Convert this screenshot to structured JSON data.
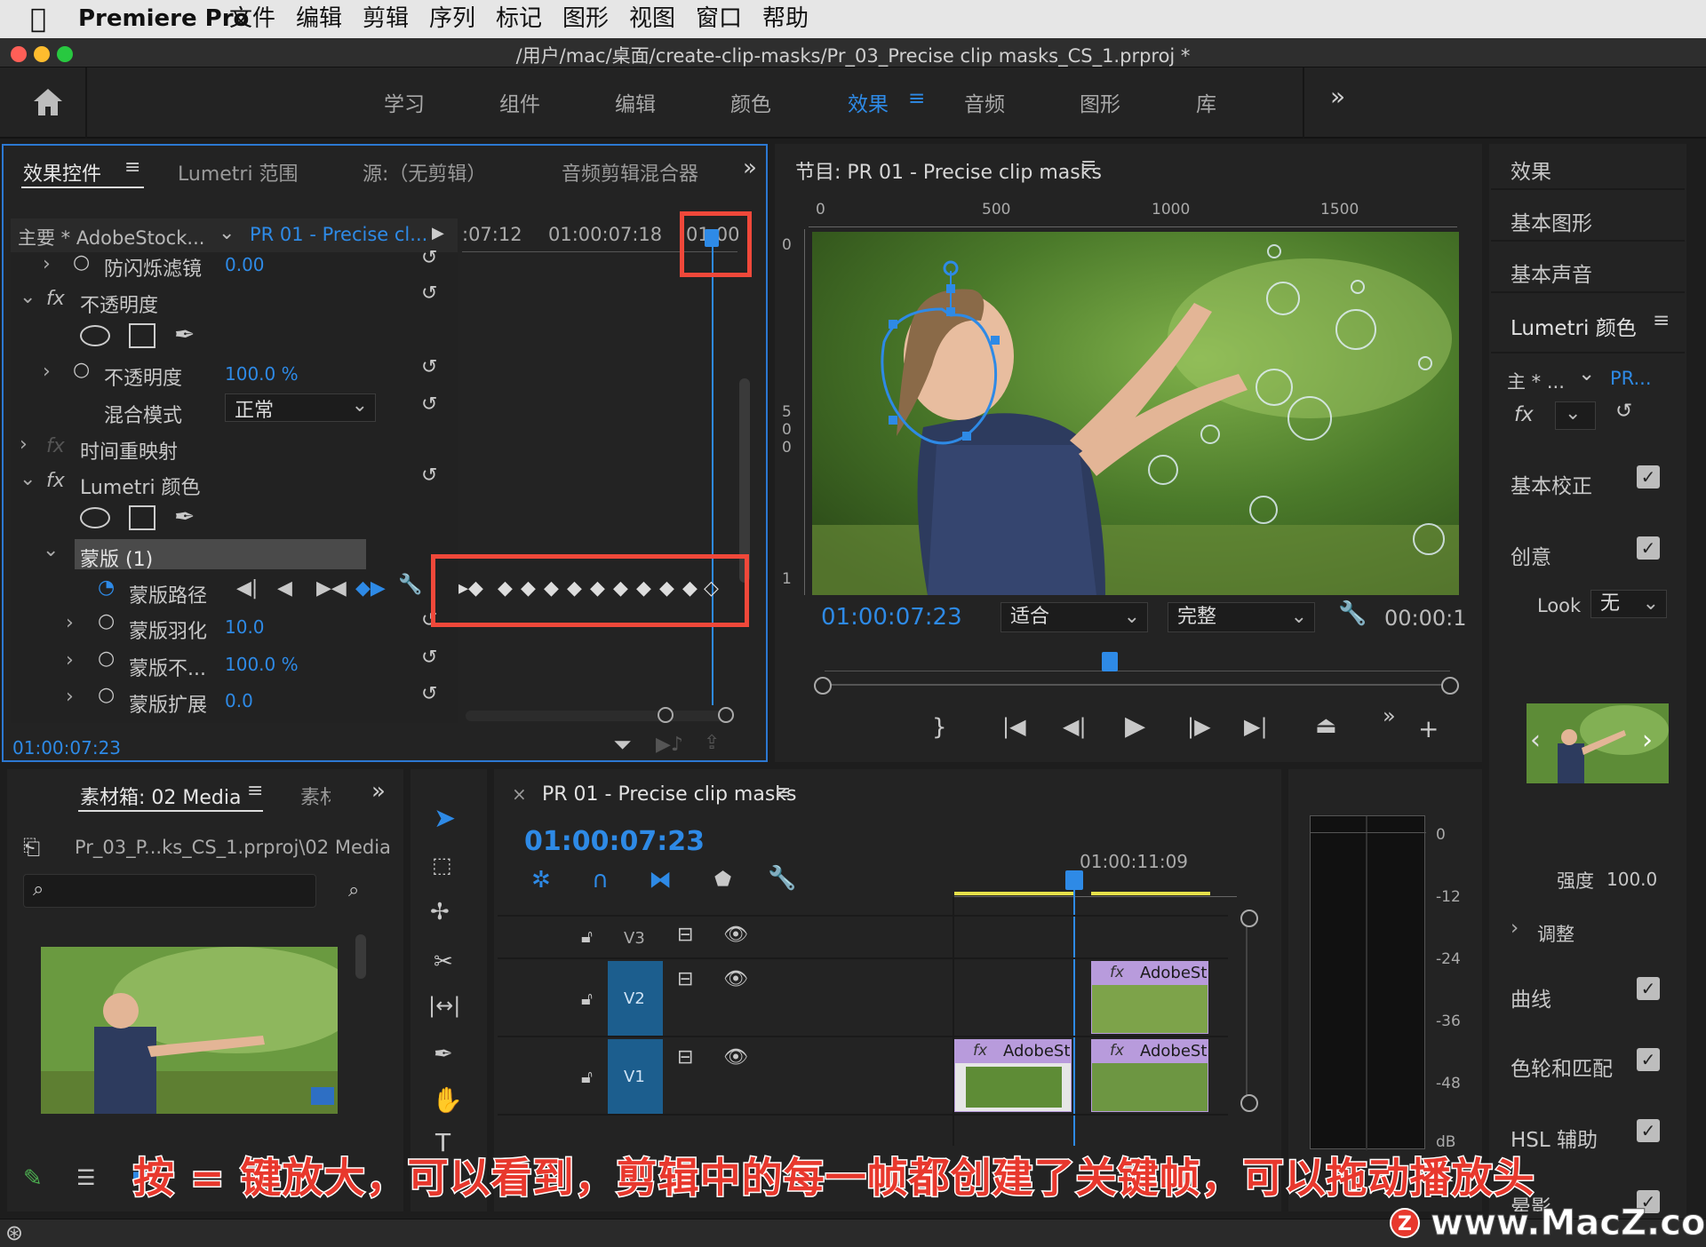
{
  "menubar": {
    "apple": "",
    "app": "Premiere Pro",
    "items": [
      "文件",
      "编辑",
      "剪辑",
      "序列",
      "标记",
      "图形",
      "视图",
      "窗口",
      "帮助"
    ]
  },
  "titlebar": {
    "path": "/用户/mac/桌面/create-clip-masks/Pr_03_Precise clip masks_CS_1.prproj *"
  },
  "workspaces": {
    "items": [
      "学习",
      "组件",
      "编辑",
      "颜色",
      "效果",
      "音频",
      "图形",
      "库"
    ],
    "active": "效果",
    "more": "»"
  },
  "effect_controls": {
    "tabs": [
      "效果控件",
      "Lumetri 范围",
      "源:（无剪辑）",
      "音频剪辑混合器"
    ],
    "master": "主要 * AdobeStock...",
    "sequence": "PR 01 - Precise cl...",
    "tc1": ":07:12",
    "tc2": "01:00:07:18",
    "tc3": "01:00",
    "rows": {
      "antiflicker": "防闪烁滤镜",
      "antiflicker_val": "0.00",
      "opacity": "不透明度",
      "opacity_prop": "不透明度",
      "opacity_val": "100.0 %",
      "blend": "混合模式",
      "blend_val": "正常",
      "timeremap": "时间重映射",
      "lumetri": "Lumetri 颜色",
      "mask": "蒙版 (1)",
      "maskpath": "蒙版路径",
      "feather": "蒙版羽化",
      "feather_val": "10.0",
      "maskopacity": "蒙版不...",
      "maskopacity_val": "100.0 %",
      "expansion": "蒙版扩展",
      "expansion_val": "0.0"
    },
    "timecode": "01:00:07:23"
  },
  "program": {
    "title": "节目: PR 01 - Precise clip masks",
    "ruler_h": [
      "0",
      "500",
      "1000",
      "1500"
    ],
    "ruler_v": [
      "0",
      "5",
      "0",
      "0",
      "1"
    ],
    "timecode": "01:00:07:23",
    "fit": "适合",
    "quality": "完整",
    "duration": "00:00:1"
  },
  "right_panel": {
    "items": [
      "效果",
      "基本图形",
      "基本声音"
    ],
    "lumetri": "Lumetri 颜色",
    "master": "主 * ...",
    "seq": "PR...",
    "basic": "基本校正",
    "creative": "创意",
    "look_label": "Look",
    "look_val": "无",
    "intensity_label": "强度",
    "intensity_val": "100.0",
    "adjust": "调整",
    "curves": "曲线",
    "wheels": "色轮和匹配",
    "hsl": "HSL 辅助",
    "shadow": "晕影"
  },
  "bin": {
    "tab": "素材箱: 02 Media",
    "tab2": "素材",
    "path": "Pr_03_P...ks_CS_1.prproj\\02 Media",
    "search_placeholder": ""
  },
  "timeline": {
    "title": "PR 01 - Precise clip masks",
    "timecode": "01:00:07:23",
    "ruler_tc": "01:00:11:09",
    "tracks": [
      "V3",
      "V2",
      "V1"
    ],
    "clips": [
      {
        "label": "AdobeSt"
      },
      {
        "label": "AdobeSt"
      },
      {
        "label": "AdobeSt"
      }
    ]
  },
  "meter": {
    "labels": [
      "0",
      "-12",
      "-24",
      "-36",
      "-48",
      "dB"
    ]
  },
  "caption": "按 = 键放大，可以看到，剪辑中的每一帧都创建了关键帧，可以拖动播放头",
  "watermark": "www.MacZ.com",
  "colors": {
    "accent": "#2e8ae6",
    "red": "#f0483a",
    "clip": "#b89bdc"
  }
}
